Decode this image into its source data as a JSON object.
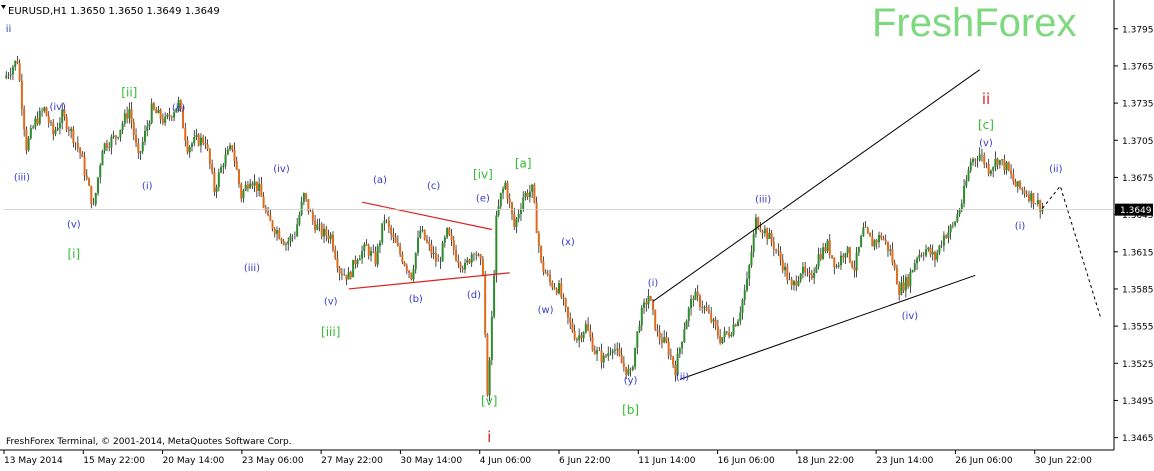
{
  "header": {
    "symbol_line": "EURUSD,H1  1.3650 1.3650 1.3649 1.3649",
    "brand": "FreshForex",
    "footer": "FreshForex Terminal, © 2001-2014, MetaQuotes Software Corp."
  },
  "colors": {
    "background": "#ffffff",
    "axis": "#000000",
    "bull_wick": "#000000",
    "bull_body": "#2e8b2e",
    "bear_body": "#e06a1a",
    "brand": "#7ed87e",
    "degree_blue": "#3a3acc",
    "degree_green": "#33bb33",
    "degree_red": "#dd2222",
    "triangle": "#dd2222",
    "channel": "#000000",
    "price_tag_bg": "#000000",
    "price_tag_fg": "#ffffff"
  },
  "chart_data": {
    "type": "line",
    "title": "EURUSD,H1",
    "ohlc_last": {
      "open": 1.365,
      "high": 1.365,
      "low": 1.3649,
      "close": 1.3649
    },
    "current_price_label": "1.3649",
    "ylim": [
      1.3455,
      1.3815
    ],
    "y_ticks": [
      "1.3795",
      "1.3765",
      "1.3735",
      "1.3705",
      "1.3675",
      "1.3645",
      "1.3615",
      "1.3585",
      "1.3555",
      "1.3525",
      "1.3495",
      "1.3465"
    ],
    "x_ticks": [
      "13 May 2014",
      "15 May 22:00",
      "20 May 14:00",
      "23 May 06:00",
      "27 May 22:00",
      "30 May 14:00",
      "4 Jun 06:00",
      "6 Jun 22:00",
      "11 Jun 14:00",
      "16 Jun 06:00",
      "18 Jun 22:00",
      "23 Jun 14:00",
      "26 Jun 06:00",
      "30 Jun 22:00"
    ],
    "price_path": [
      [
        0,
        1.3755
      ],
      [
        1.5,
        1.377
      ],
      [
        2.5,
        1.37
      ],
      [
        3.5,
        1.372
      ],
      [
        4.5,
        1.373
      ],
      [
        5.5,
        1.371
      ],
      [
        6.5,
        1.3725
      ],
      [
        7.5,
        1.3712
      ],
      [
        8.5,
        1.3695
      ],
      [
        10,
        1.365
      ],
      [
        11,
        1.37
      ],
      [
        12.5,
        1.3708
      ],
      [
        14,
        1.373
      ],
      [
        15,
        1.369
      ],
      [
        16.5,
        1.373
      ],
      [
        18,
        1.372
      ],
      [
        19.5,
        1.3735
      ],
      [
        20.5,
        1.37
      ],
      [
        21.5,
        1.3705
      ],
      [
        22.5,
        1.3705
      ],
      [
        23.5,
        1.3665
      ],
      [
        24.5,
        1.3688
      ],
      [
        25.5,
        1.37
      ],
      [
        26.5,
        1.366
      ],
      [
        27.5,
        1.3675
      ],
      [
        28.5,
        1.3665
      ],
      [
        29.5,
        1.364
      ],
      [
        30.5,
        1.3632
      ],
      [
        31.5,
        1.3622
      ],
      [
        32.5,
        1.363
      ],
      [
        33.5,
        1.366
      ],
      [
        34.5,
        1.364
      ],
      [
        35.5,
        1.363
      ],
      [
        36.5,
        1.3628
      ],
      [
        37.5,
        1.36
      ],
      [
        38.5,
        1.3595
      ],
      [
        39.5,
        1.3612
      ],
      [
        40.5,
        1.3618
      ],
      [
        41.5,
        1.3608
      ],
      [
        42.5,
        1.3642
      ],
      [
        43.5,
        1.3624
      ],
      [
        44.5,
        1.361
      ],
      [
        45.5,
        1.3596
      ],
      [
        46.5,
        1.3632
      ],
      [
        47.5,
        1.3618
      ],
      [
        48.5,
        1.3605
      ],
      [
        49.5,
        1.363
      ],
      [
        50.5,
        1.3612
      ],
      [
        51.5,
        1.3602
      ],
      [
        52.5,
        1.3618
      ],
      [
        53.5,
        1.36
      ],
      [
        54,
        1.3495
      ],
      [
        54.5,
        1.356
      ],
      [
        55,
        1.364
      ],
      [
        55.5,
        1.366
      ],
      [
        56,
        1.367
      ],
      [
        57,
        1.3635
      ],
      [
        58,
        1.366
      ],
      [
        59,
        1.3665
      ],
      [
        60,
        1.3605
      ],
      [
        61,
        1.359
      ],
      [
        62,
        1.3585
      ],
      [
        63,
        1.356
      ],
      [
        64,
        1.3545
      ],
      [
        65,
        1.3555
      ],
      [
        66,
        1.3535
      ],
      [
        67,
        1.3528
      ],
      [
        68,
        1.354
      ],
      [
        69,
        1.3525
      ],
      [
        70,
        1.3515
      ],
      [
        71,
        1.356
      ],
      [
        72,
        1.358
      ],
      [
        73,
        1.3548
      ],
      [
        74,
        1.354
      ],
      [
        75,
        1.352
      ],
      [
        76,
        1.3555
      ],
      [
        77,
        1.358
      ],
      [
        78,
        1.3572
      ],
      [
        79,
        1.356
      ],
      [
        80,
        1.3545
      ],
      [
        81,
        1.355
      ],
      [
        82,
        1.3562
      ],
      [
        83,
        1.359
      ],
      [
        84,
        1.364
      ],
      [
        85,
        1.3632
      ],
      [
        86,
        1.362
      ],
      [
        87,
        1.3605
      ],
      [
        88,
        1.3585
      ],
      [
        89,
        1.36
      ],
      [
        90,
        1.3592
      ],
      [
        91,
        1.3612
      ],
      [
        92,
        1.362
      ],
      [
        93,
        1.3603
      ],
      [
        94,
        1.3618
      ],
      [
        95,
        1.3602
      ],
      [
        96,
        1.3632
      ],
      [
        97,
        1.3622
      ],
      [
        98,
        1.3628
      ],
      [
        99,
        1.3615
      ],
      [
        100,
        1.3585
      ],
      [
        101,
        1.3592
      ],
      [
        102,
        1.3612
      ],
      [
        103,
        1.3617
      ],
      [
        104,
        1.361
      ],
      [
        105,
        1.3628
      ],
      [
        106,
        1.3635
      ],
      [
        107,
        1.3655
      ],
      [
        108,
        1.3688
      ],
      [
        109,
        1.3694
      ],
      [
        110,
        1.3682
      ],
      [
        111,
        1.369
      ],
      [
        112,
        1.3683
      ],
      [
        113,
        1.3668
      ],
      [
        114,
        1.3664
      ],
      [
        115,
        1.3658
      ],
      [
        116,
        1.365
      ]
    ],
    "annotations": [
      {
        "text": "ii",
        "x": 0.5,
        "y": 1.3795,
        "level": "blue"
      },
      {
        "text": "(iv)",
        "x": 6,
        "y": 1.3732,
        "level": "blue"
      },
      {
        "text": "[ii]",
        "x": 14,
        "y": 1.3743,
        "level": "green"
      },
      {
        "text": "(ii)",
        "x": 19.5,
        "y": 1.3731,
        "level": "blue"
      },
      {
        "text": "(iii)",
        "x": 2,
        "y": 1.3675,
        "level": "blue"
      },
      {
        "text": "(i)",
        "x": 16,
        "y": 1.3668,
        "level": "blue"
      },
      {
        "text": "(iv)",
        "x": 31,
        "y": 1.3682,
        "level": "blue"
      },
      {
        "text": "(v)",
        "x": 7.8,
        "y": 1.3637,
        "level": "blue"
      },
      {
        "text": "[i]",
        "x": 7.8,
        "y": 1.3613,
        "level": "green"
      },
      {
        "text": "(iii)",
        "x": 27.7,
        "y": 1.3602,
        "level": "blue"
      },
      {
        "text": "(a)",
        "x": 42,
        "y": 1.3673,
        "level": "blue"
      },
      {
        "text": "(c)",
        "x": 48,
        "y": 1.3668,
        "level": "blue"
      },
      {
        "text": "[iv]",
        "x": 53.5,
        "y": 1.3677,
        "level": "green"
      },
      {
        "text": "[a]",
        "x": 58,
        "y": 1.3686,
        "level": "green"
      },
      {
        "text": "(e)",
        "x": 53.5,
        "y": 1.3658,
        "level": "blue"
      },
      {
        "text": "(x)",
        "x": 63,
        "y": 1.3623,
        "level": "blue"
      },
      {
        "text": "(v)",
        "x": 36.5,
        "y": 1.3575,
        "level": "blue"
      },
      {
        "text": "(b)",
        "x": 46,
        "y": 1.3577,
        "level": "blue"
      },
      {
        "text": "(d)",
        "x": 52.5,
        "y": 1.358,
        "level": "blue"
      },
      {
        "text": "(w)",
        "x": 60.5,
        "y": 1.3568,
        "level": "blue"
      },
      {
        "text": "[iii]",
        "x": 36.5,
        "y": 1.355,
        "level": "green"
      },
      {
        "text": "(i)",
        "x": 72.5,
        "y": 1.359,
        "level": "blue"
      },
      {
        "text": "(iii)",
        "x": 84.8,
        "y": 1.3657,
        "level": "blue"
      },
      {
        "text": "(iv)",
        "x": 101.2,
        "y": 1.3563,
        "level": "blue"
      },
      {
        "text": "(ii)",
        "x": 75.8,
        "y": 1.3514,
        "level": "blue"
      },
      {
        "text": "(y)",
        "x": 70,
        "y": 1.3511,
        "level": "blue"
      },
      {
        "text": "[b]",
        "x": 70,
        "y": 1.3487,
        "level": "green"
      },
      {
        "text": "[v]",
        "x": 54.2,
        "y": 1.3494,
        "level": "green"
      },
      {
        "text": "i",
        "x": 54.2,
        "y": 1.3465,
        "level": "red"
      },
      {
        "text": "ii",
        "x": 109.7,
        "y": 1.3738,
        "level": "red"
      },
      {
        "text": "[c]",
        "x": 109.7,
        "y": 1.3717,
        "level": "green"
      },
      {
        "text": "(v)",
        "x": 109.7,
        "y": 1.3703,
        "level": "blue"
      },
      {
        "text": "(i)",
        "x": 113.5,
        "y": 1.3636,
        "level": "blue"
      },
      {
        "text": "(ii)",
        "x": 117.5,
        "y": 1.3682,
        "level": "blue"
      }
    ],
    "triangle_lines": [
      [
        [
          40,
          1.3655
        ],
        [
          54.5,
          1.3633
        ]
      ],
      [
        [
          38.5,
          1.3585
        ],
        [
          56.5,
          1.3598
        ]
      ]
    ],
    "channel_lines": [
      [
        [
          72.5,
          1.3575
        ],
        [
          109,
          1.3762
        ]
      ],
      [
        [
          75.5,
          1.3512
        ],
        [
          108.5,
          1.3596
        ]
      ]
    ],
    "forecast_path": [
      [
        116,
        1.365
      ],
      [
        118,
        1.3668
      ],
      [
        122.5,
        1.3562
      ]
    ]
  }
}
